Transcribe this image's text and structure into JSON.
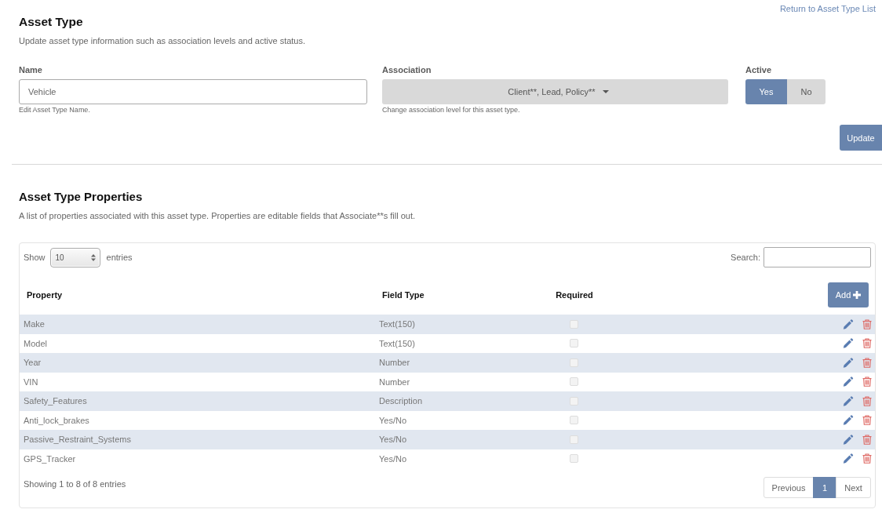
{
  "header": {
    "title": "Asset Type",
    "return_link": "Return to Asset Type List",
    "description": "Update asset type information such as association levels and active status."
  },
  "form": {
    "name": {
      "label": "Name",
      "value": "Vehicle",
      "help": "Edit Asset Type Name."
    },
    "association": {
      "label": "Association",
      "value": "Client**, Lead, Policy**",
      "help": "Change association level for this asset type."
    },
    "active": {
      "label": "Active",
      "options": [
        {
          "label": "Yes",
          "selected": true
        },
        {
          "label": "No",
          "selected": false
        }
      ]
    },
    "update_button": "Update"
  },
  "properties": {
    "title": "Asset Type Properties",
    "description": "A list of properties associated with this asset type. Properties are editable fields that Associate**s fill out."
  },
  "table": {
    "length": {
      "label_before": "Show",
      "value": "10",
      "label_after": "entries"
    },
    "search": {
      "label": "Search:"
    },
    "columns": [
      "Property",
      "Field Type",
      "Required"
    ],
    "add_button": "Add",
    "rows": [
      {
        "property": "Make",
        "field_type": "Text(150)",
        "required": false
      },
      {
        "property": "Model",
        "field_type": "Text(150)",
        "required": false
      },
      {
        "property": "Year",
        "field_type": "Number",
        "required": false
      },
      {
        "property": "VIN",
        "field_type": "Number",
        "required": false
      },
      {
        "property": "Safety_Features",
        "field_type": "Description",
        "required": false
      },
      {
        "property": "Anti_lock_brakes",
        "field_type": "Yes/No",
        "required": false
      },
      {
        "property": "Passive_Restraint_Systems",
        "field_type": "Yes/No",
        "required": false
      },
      {
        "property": "GPS_Tracker",
        "field_type": "Yes/No",
        "required": false
      }
    ],
    "info": "Showing 1 to 8 of 8 entries",
    "pagination": [
      {
        "label": "Previous",
        "selected": false
      },
      {
        "label": "1",
        "selected": true
      },
      {
        "label": "Next",
        "selected": false
      }
    ]
  }
}
